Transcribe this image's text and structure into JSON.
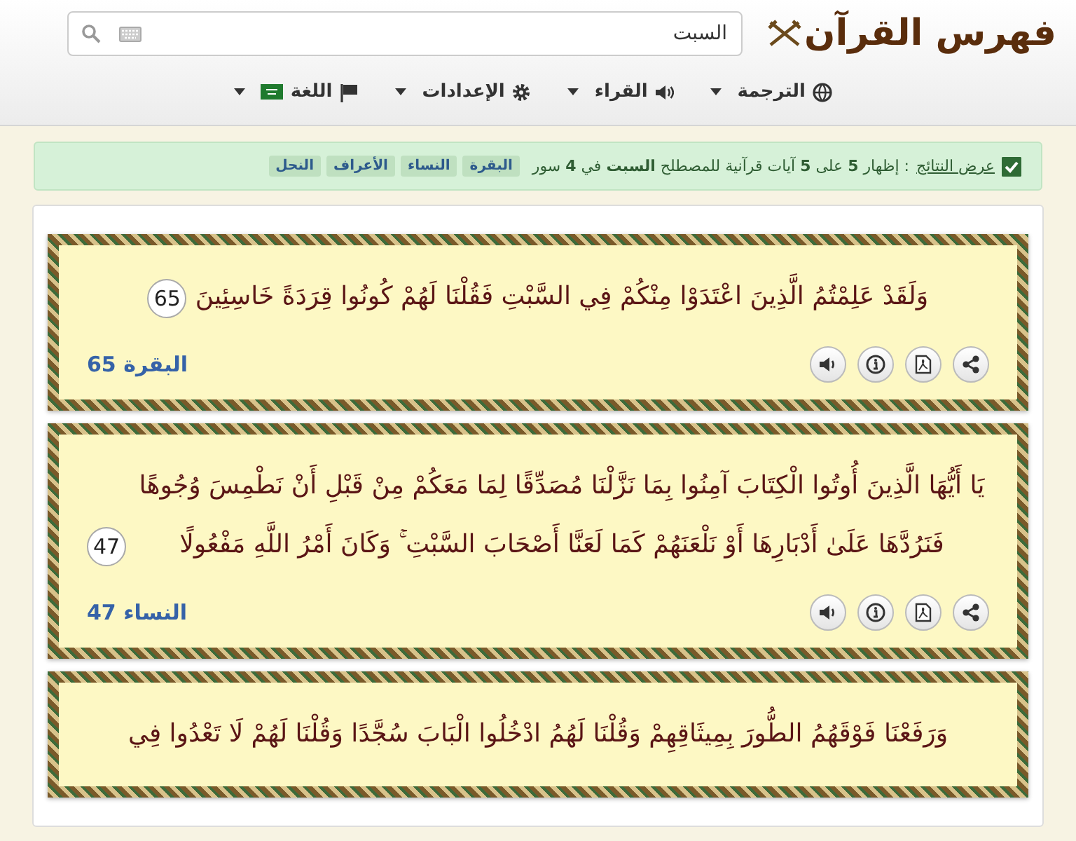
{
  "header": {
    "logo": "فهرس القرآن",
    "search": {
      "value": "السبت"
    }
  },
  "nav": [
    {
      "label": "الترجمة"
    },
    {
      "label": "القراء"
    },
    {
      "label": "الإعدادات"
    },
    {
      "label": "اللغة"
    }
  ],
  "alert": {
    "checked": true,
    "label": "عرض النتائج",
    "text": ": إظهار **5** على **5** آيات قرآنية للمصطلح **السبت** في **4** سور",
    "tags": [
      "البقرة",
      "النساء",
      "الأعراف",
      "النحل"
    ]
  },
  "verses": [
    {
      "text": "وَلَقَدْ عَلِمْتُمُ الَّذِينَ اعْتَدَوْا مِنْكُمْ فِي السَّبْتِ فَقُلْنَا لَهُمْ كُونُوا قِرَدَةً خَاسِئِينَ",
      "number": "65",
      "reference": "البقرة 65"
    },
    {
      "text": "يَا أَيُّهَا الَّذِينَ أُوتُوا الْكِتَابَ آمِنُوا بِمَا نَزَّلْنَا مُصَدِّقًا لِمَا مَعَكُمْ مِنْ قَبْلِ أَنْ نَطْمِسَ وُجُوهًا فَنَرُدَّهَا عَلَىٰ أَدْبَارِهَا أَوْ نَلْعَنَهُمْ كَمَا لَعَنَّا أَصْحَابَ السَّبْتِ ۚ وَكَانَ أَمْرُ اللَّهِ مَفْعُولًا",
      "number": "47",
      "reference": "النساء 47"
    },
    {
      "text": "وَرَفَعْنَا فَوْقَهُمُ الطُّورَ بِمِيثَاقِهِمْ وَقُلْنَا لَهُمُ ادْخُلُوا الْبَابَ سُجَّدًا وَقُلْنَا لَهُمْ لَا تَعْدُوا فِي"
    }
  ]
}
